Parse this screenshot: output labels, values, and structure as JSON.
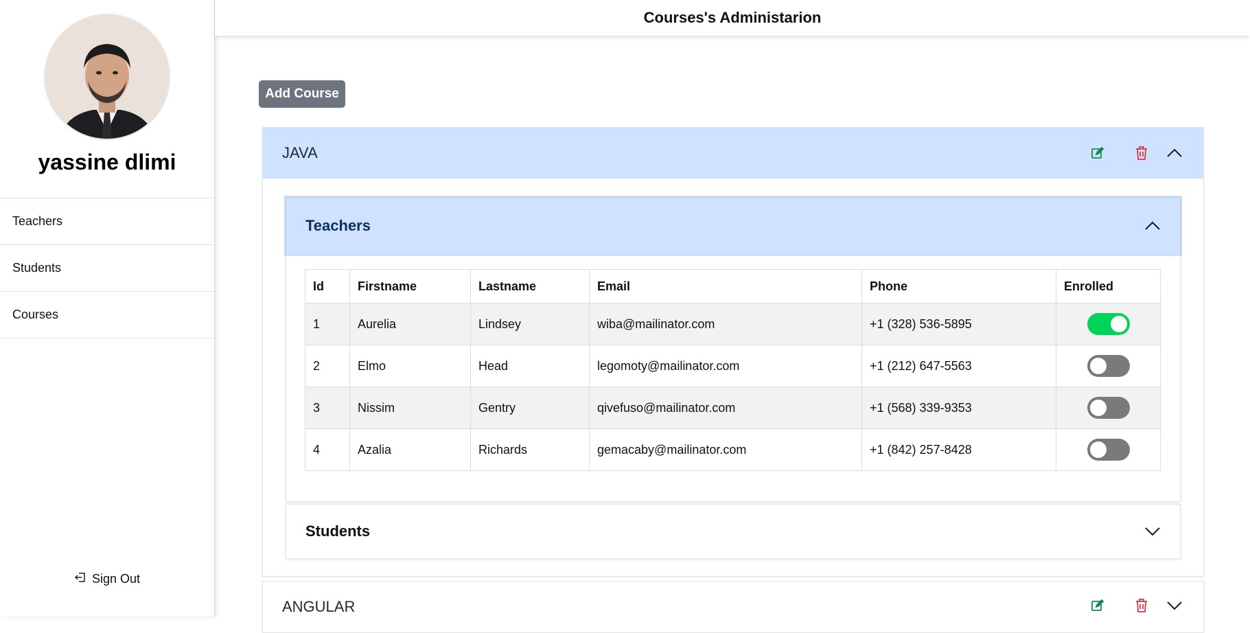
{
  "header": {
    "title": "Courses's Administarion"
  },
  "sidebar": {
    "username": "yassine dlimi",
    "items": [
      {
        "label": "Teachers"
      },
      {
        "label": "Students"
      },
      {
        "label": "Courses"
      }
    ],
    "signout_label": "Sign Out"
  },
  "toolbar": {
    "add_course_label": "Add Course"
  },
  "courses": [
    {
      "name": "JAVA",
      "expanded": true,
      "sections": [
        {
          "title": "Teachers",
          "expanded": true,
          "columns": [
            "Id",
            "Firstname",
            "Lastname",
            "Email",
            "Phone",
            "Enrolled"
          ],
          "rows": [
            {
              "id": "1",
              "firstname": "Aurelia",
              "lastname": "Lindsey",
              "email": "wiba@mailinator.com",
              "phone": "+1 (328) 536-5895",
              "enrolled": true
            },
            {
              "id": "2",
              "firstname": "Elmo",
              "lastname": "Head",
              "email": "legomoty@mailinator.com",
              "phone": "+1 (212) 647-5563",
              "enrolled": false
            },
            {
              "id": "3",
              "firstname": "Nissim",
              "lastname": "Gentry",
              "email": "qivefuso@mailinator.com",
              "phone": "+1 (568) 339-9353",
              "enrolled": false
            },
            {
              "id": "4",
              "firstname": "Azalia",
              "lastname": "Richards",
              "email": "gemacaby@mailinator.com",
              "phone": "+1 (842) 257-8428",
              "enrolled": false
            }
          ]
        },
        {
          "title": "Students",
          "expanded": false
        }
      ]
    },
    {
      "name": "ANGULAR",
      "expanded": false
    }
  ],
  "colors": {
    "accent_open": "#cfe2ff",
    "toggle_on": "#00d35a",
    "toggle_off": "#7a7a7a",
    "edit_icon": "#198754",
    "delete_icon": "#dc3545"
  },
  "icons": [
    "user-avatar-photo",
    "edit-icon",
    "trash-icon",
    "chevron-up-icon",
    "chevron-down-icon",
    "sign-out-icon"
  ]
}
